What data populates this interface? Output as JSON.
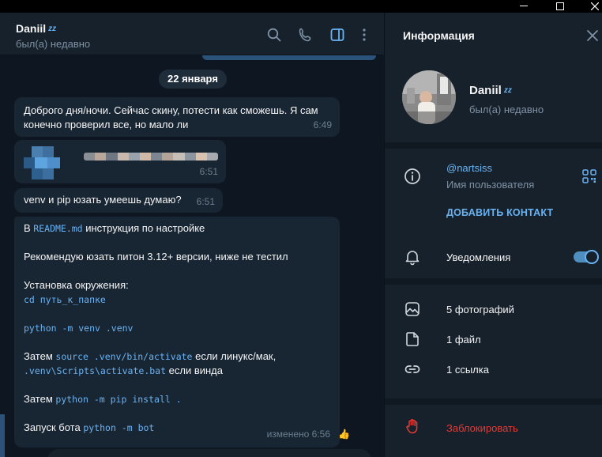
{
  "window": {
    "minimize_glyph": "—",
    "maximize_glyph": "☐",
    "close_glyph": "✕"
  },
  "chat": {
    "header": {
      "name": "Daniil",
      "sleep_badge": "zz",
      "status": "был(а) недавно",
      "icons": [
        "search-icon",
        "phone-icon",
        "sidebar-panel-icon",
        "more-vertical-icon"
      ]
    },
    "date_separator": "22 января",
    "messages": [
      {
        "lines": [
          "Доброго дня/ночи. Сейчас скину, потести как сможешь. Я сам",
          "конечно проверил все, но мало ли"
        ],
        "time": "6:49"
      },
      {
        "time": "6:51"
      },
      {
        "text": "venv и pip юзать умеешь думаю?",
        "time": "6:51"
      },
      {
        "readme_prefix": "В ",
        "readme_code": "README.md",
        "readme_suffix": " инструкция по настройке",
        "recommend": "Рекомендую юзать питон 3.12+ версии, ниже не тестил",
        "install_title": "Установка окружения:",
        "cd_code": "cd путь_к_папке",
        "venv_code": "python -m venv .venv",
        "then1_prefix": "Затем ",
        "then1_code1": "source .venv/bin/activate",
        "then1_mid": " если линукс/мак,",
        "then1_code2": ".venv\\Scripts\\activate.bat",
        "then1_suffix": " если винда",
        "then2_prefix": "Затем ",
        "then2_code": "python -m pip install .",
        "run_prefix": "Запуск бота ",
        "run_code": "python -m bot",
        "edited": "изменено 6:56",
        "reaction": "👍"
      }
    ]
  },
  "info": {
    "title": "Информация",
    "name": "Daniil",
    "sleep_badge": "zz",
    "status": "был(а) недавно",
    "username": "@nartsiss",
    "username_caption": "Имя пользователя",
    "add_contact": "ДОБАВИТЬ КОНТАКТ",
    "notifications": "Уведомления",
    "notifications_enabled": true,
    "photos": "5 фотографий",
    "files": "1 файл",
    "links": "1 ссылка",
    "block": "Заблокировать"
  },
  "colors": {
    "accent": "#6ab3f3",
    "danger": "#e53935",
    "bubble": "#182533",
    "panel": "#17212b",
    "background": "#0e1621"
  }
}
